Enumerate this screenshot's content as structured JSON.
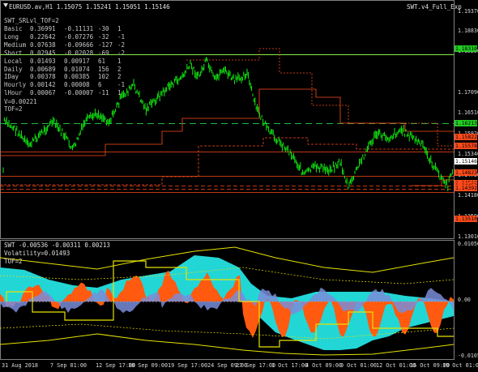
{
  "header": {
    "symbol_line": "EURUSD.av,H1  1.15075 1.15241 1.15051 1.15146",
    "indicator_name": "SWT.v4_Full_Exp"
  },
  "stats": {
    "title": "SWT_SRLvl_TOF=2",
    "rows": [
      [
        "Basic",
        "0.36991",
        "-0.11131",
        "-30",
        "1"
      ],
      [
        "Long",
        "0.22642",
        "-0.07276",
        "-32",
        "-1"
      ],
      [
        "Medium",
        "0.07638",
        "-0.09666",
        "-127",
        "-2"
      ],
      [
        "Short",
        "0.02945",
        "-0.02028",
        "-69",
        "-2"
      ],
      [
        "Local",
        "0.01493",
        "0.00917",
        "61",
        "1"
      ],
      [
        "Daily",
        "0.00689",
        "0.01074",
        "156",
        "2"
      ],
      [
        "IDay",
        "0.00378",
        "0.00385",
        "102",
        "2"
      ],
      [
        "Hourly",
        "0.00142",
        "0.00008",
        "6",
        "-1"
      ],
      [
        "lHour",
        "0.00067",
        "-0.00007",
        "-11",
        "1"
      ]
    ],
    "v_line": "V=0.00221",
    "tof_line": "TOF=2"
  },
  "price_axis": {
    "ticks": [
      "1.19370",
      "1.18830",
      "1.18250",
      "1.17090",
      "1.16510",
      "1.15920",
      "1.15340",
      "1.14750",
      "1.14180",
      "1.13590",
      "1.13010"
    ],
    "tick_values": [
      1.1937,
      1.1883,
      1.1825,
      1.1709,
      1.1651,
      1.1592,
      1.1534,
      1.1475,
      1.1418,
      1.1359,
      1.1301
    ],
    "tags": [
      {
        "text": "1.18310",
        "bg": "#22cc22",
        "fg": "#000000",
        "value": 1.1831
      },
      {
        "text": "1.16213",
        "bg": "#22cc22",
        "fg": "#000000",
        "value": 1.16213
      },
      {
        "text": "1.15822",
        "bg": "#ff4a1a",
        "fg": "#000000",
        "value": 1.15822
      },
      {
        "text": "1.15578",
        "bg": "#ff4a1a",
        "fg": "#000000",
        "value": 1.15578
      },
      {
        "text": "1.15146",
        "bg": "#ffffff",
        "fg": "#000000",
        "value": 1.15146
      },
      {
        "text": "1.14823",
        "bg": "#ff4a1a",
        "fg": "#000000",
        "value": 1.14823
      },
      {
        "text": "1.14516",
        "bg": "#ff4a1a",
        "fg": "#000000",
        "value": 1.14516
      },
      {
        "text": "1.14452",
        "bg": "#ff4a1a",
        "fg": "#000000",
        "value": 1.14452
      },
      {
        "text": "1.14392",
        "bg": "#ff4a1a",
        "fg": "#000000",
        "value": 1.14392
      },
      {
        "text": "1.13510",
        "bg": "#ff4a1a",
        "fg": "#000000",
        "value": 1.1351
      }
    ]
  },
  "sub_window": {
    "header": "SWT -0.00536 -0.00311 0.00213",
    "volatility": "Volatility=0.01493",
    "tof": "TOF=2",
    "ticks": [
      "0.01050",
      "0.00",
      "-0.01050"
    ],
    "tick_values": [
      0.0105,
      0.0,
      -0.0105
    ]
  },
  "time_axis": {
    "labels": [
      "31 Aug 2018",
      "7 Sep 01:00",
      "12 Sep 17:00",
      "18 Sep 09:00",
      "19 Sep 17:00",
      "24 Sep 09:00",
      "27 Sep 17:00",
      "1 Oct 17:00",
      "4 Oct 09:00",
      "9 Oct 01:00",
      "12 Oct 01:00",
      "16 Oct 09:00",
      "19 Oct 01:00"
    ]
  },
  "colors": {
    "background": "#000000",
    "candles": "#11ee11",
    "support_green": "#88ee44",
    "resistance_red": "#ff4a1a",
    "band_cyan": "#22d6d6",
    "band_orange": "#ff5a10",
    "band_blue": "#7a8cd8",
    "envelope_yellow": "#e6e200"
  }
}
